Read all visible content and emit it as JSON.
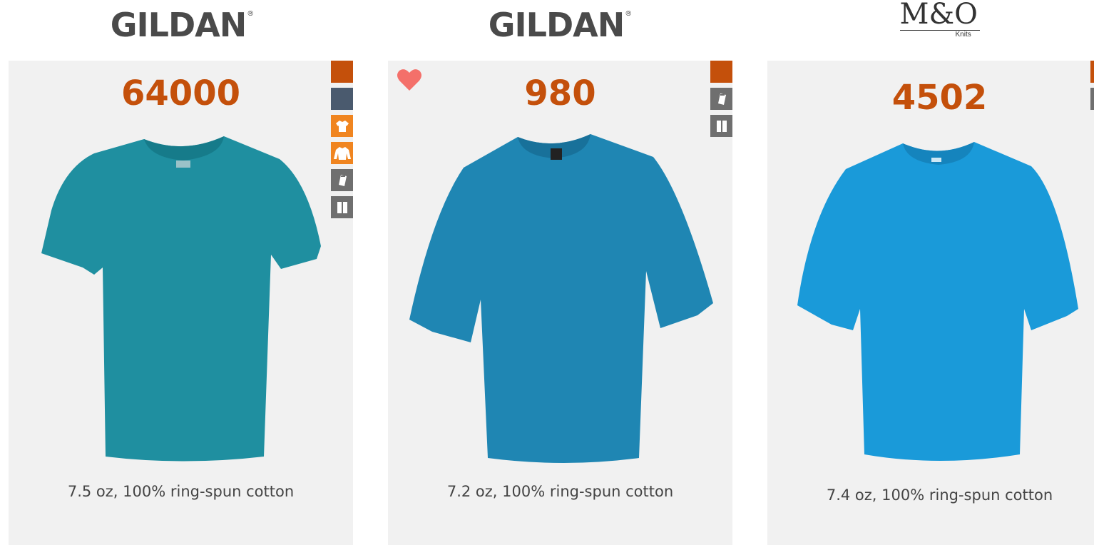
{
  "products": [
    {
      "brand": "GILDAN",
      "style": "64000",
      "description": "7.5 oz, 100% ring-spun cotton",
      "shirt_color": "#1f8fa0",
      "icons": [
        "color-swatch-icon",
        "gray-swatch-icon",
        "tshirt-icon",
        "long-sleeve-icon",
        "tag-icon",
        "pause-icon"
      ],
      "favorited": false
    },
    {
      "brand": "GILDAN",
      "style": "980",
      "description": "7.2 oz, 100% ring-spun cotton",
      "shirt_color": "#1f86b3",
      "icons": [
        "color-swatch-icon",
        "tag-icon",
        "pause-icon"
      ],
      "favorited": true
    },
    {
      "brand": "M&O",
      "brand_sub": "Knits",
      "style": "4502",
      "description": "7.4 oz, 100% ring-spun cotton",
      "shirt_color": "#1a9ad9",
      "icons": [
        "color-swatch-icon",
        "gray-swatch-icon"
      ],
      "favorited": false
    }
  ],
  "brand_registered_mark": "®",
  "colors": {
    "accent": "#c4500b",
    "orange_icon": "#f08520",
    "slate_icon": "#4a5a6e",
    "gray_icon": "#6f6f6f",
    "heart": "#f4706a",
    "card_bg": "#f1f1f1"
  }
}
